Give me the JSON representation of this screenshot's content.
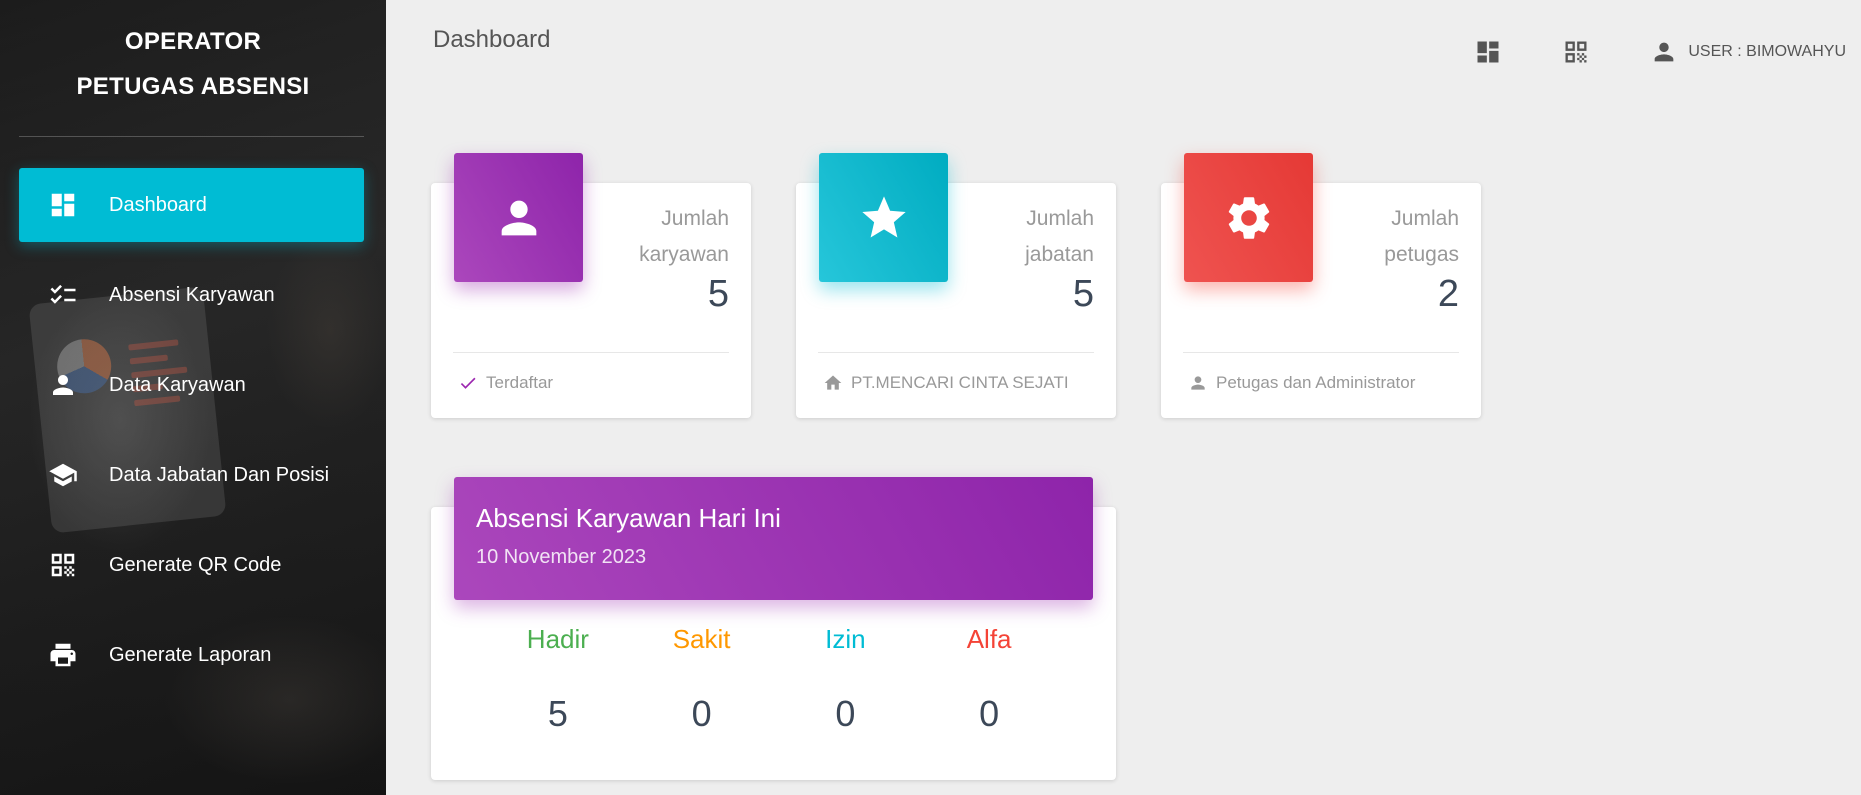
{
  "sidebar": {
    "title_line1": "OPERATOR",
    "title_line2": "PETUGAS ABSENSI",
    "items": [
      {
        "label": "Dashboard",
        "icon": "dashboard-icon",
        "active": true
      },
      {
        "label": "Absensi Karyawan",
        "icon": "checklist-icon"
      },
      {
        "label": "Data Karyawan",
        "icon": "person-icon"
      },
      {
        "label": "Data Jabatan Dan Posisi",
        "icon": "school-icon"
      },
      {
        "label": "Generate QR Code",
        "icon": "qr-code-icon"
      },
      {
        "label": "Generate Laporan",
        "icon": "printer-icon"
      }
    ]
  },
  "header": {
    "page_title": "Dashboard",
    "user_label": "USER : BIMOWAHYU"
  },
  "stats": [
    {
      "label": "Jumlah karyawan",
      "value": "5",
      "footer": "Terdaftar",
      "footer_icon": "check-icon",
      "color": "#9c27b0"
    },
    {
      "label": "Jumlah jabatan",
      "value": "5",
      "footer": "PT.MENCARI CINTA SEJATI",
      "footer_icon": "home-icon",
      "color": "#00bcd4"
    },
    {
      "label": "Jumlah petugas",
      "value": "2",
      "footer": "Petugas dan Administrator",
      "footer_icon": "person-icon",
      "color": "#f44336"
    }
  ],
  "attendance": {
    "title": "Absensi Karyawan Hari Ini",
    "date": "10 November 2023",
    "columns": [
      {
        "label": "Hadir",
        "value": "5",
        "color": "#4caf50"
      },
      {
        "label": "Sakit",
        "value": "0",
        "color": "#ff9800"
      },
      {
        "label": "Izin",
        "value": "0",
        "color": "#00bcd4"
      },
      {
        "label": "Alfa",
        "value": "0",
        "color": "#f44336"
      }
    ]
  },
  "colors": {
    "accent_cyan": "#00bcd4",
    "accent_purple": "#9c27b0",
    "accent_red": "#f44336",
    "background": "#eeeeee"
  }
}
